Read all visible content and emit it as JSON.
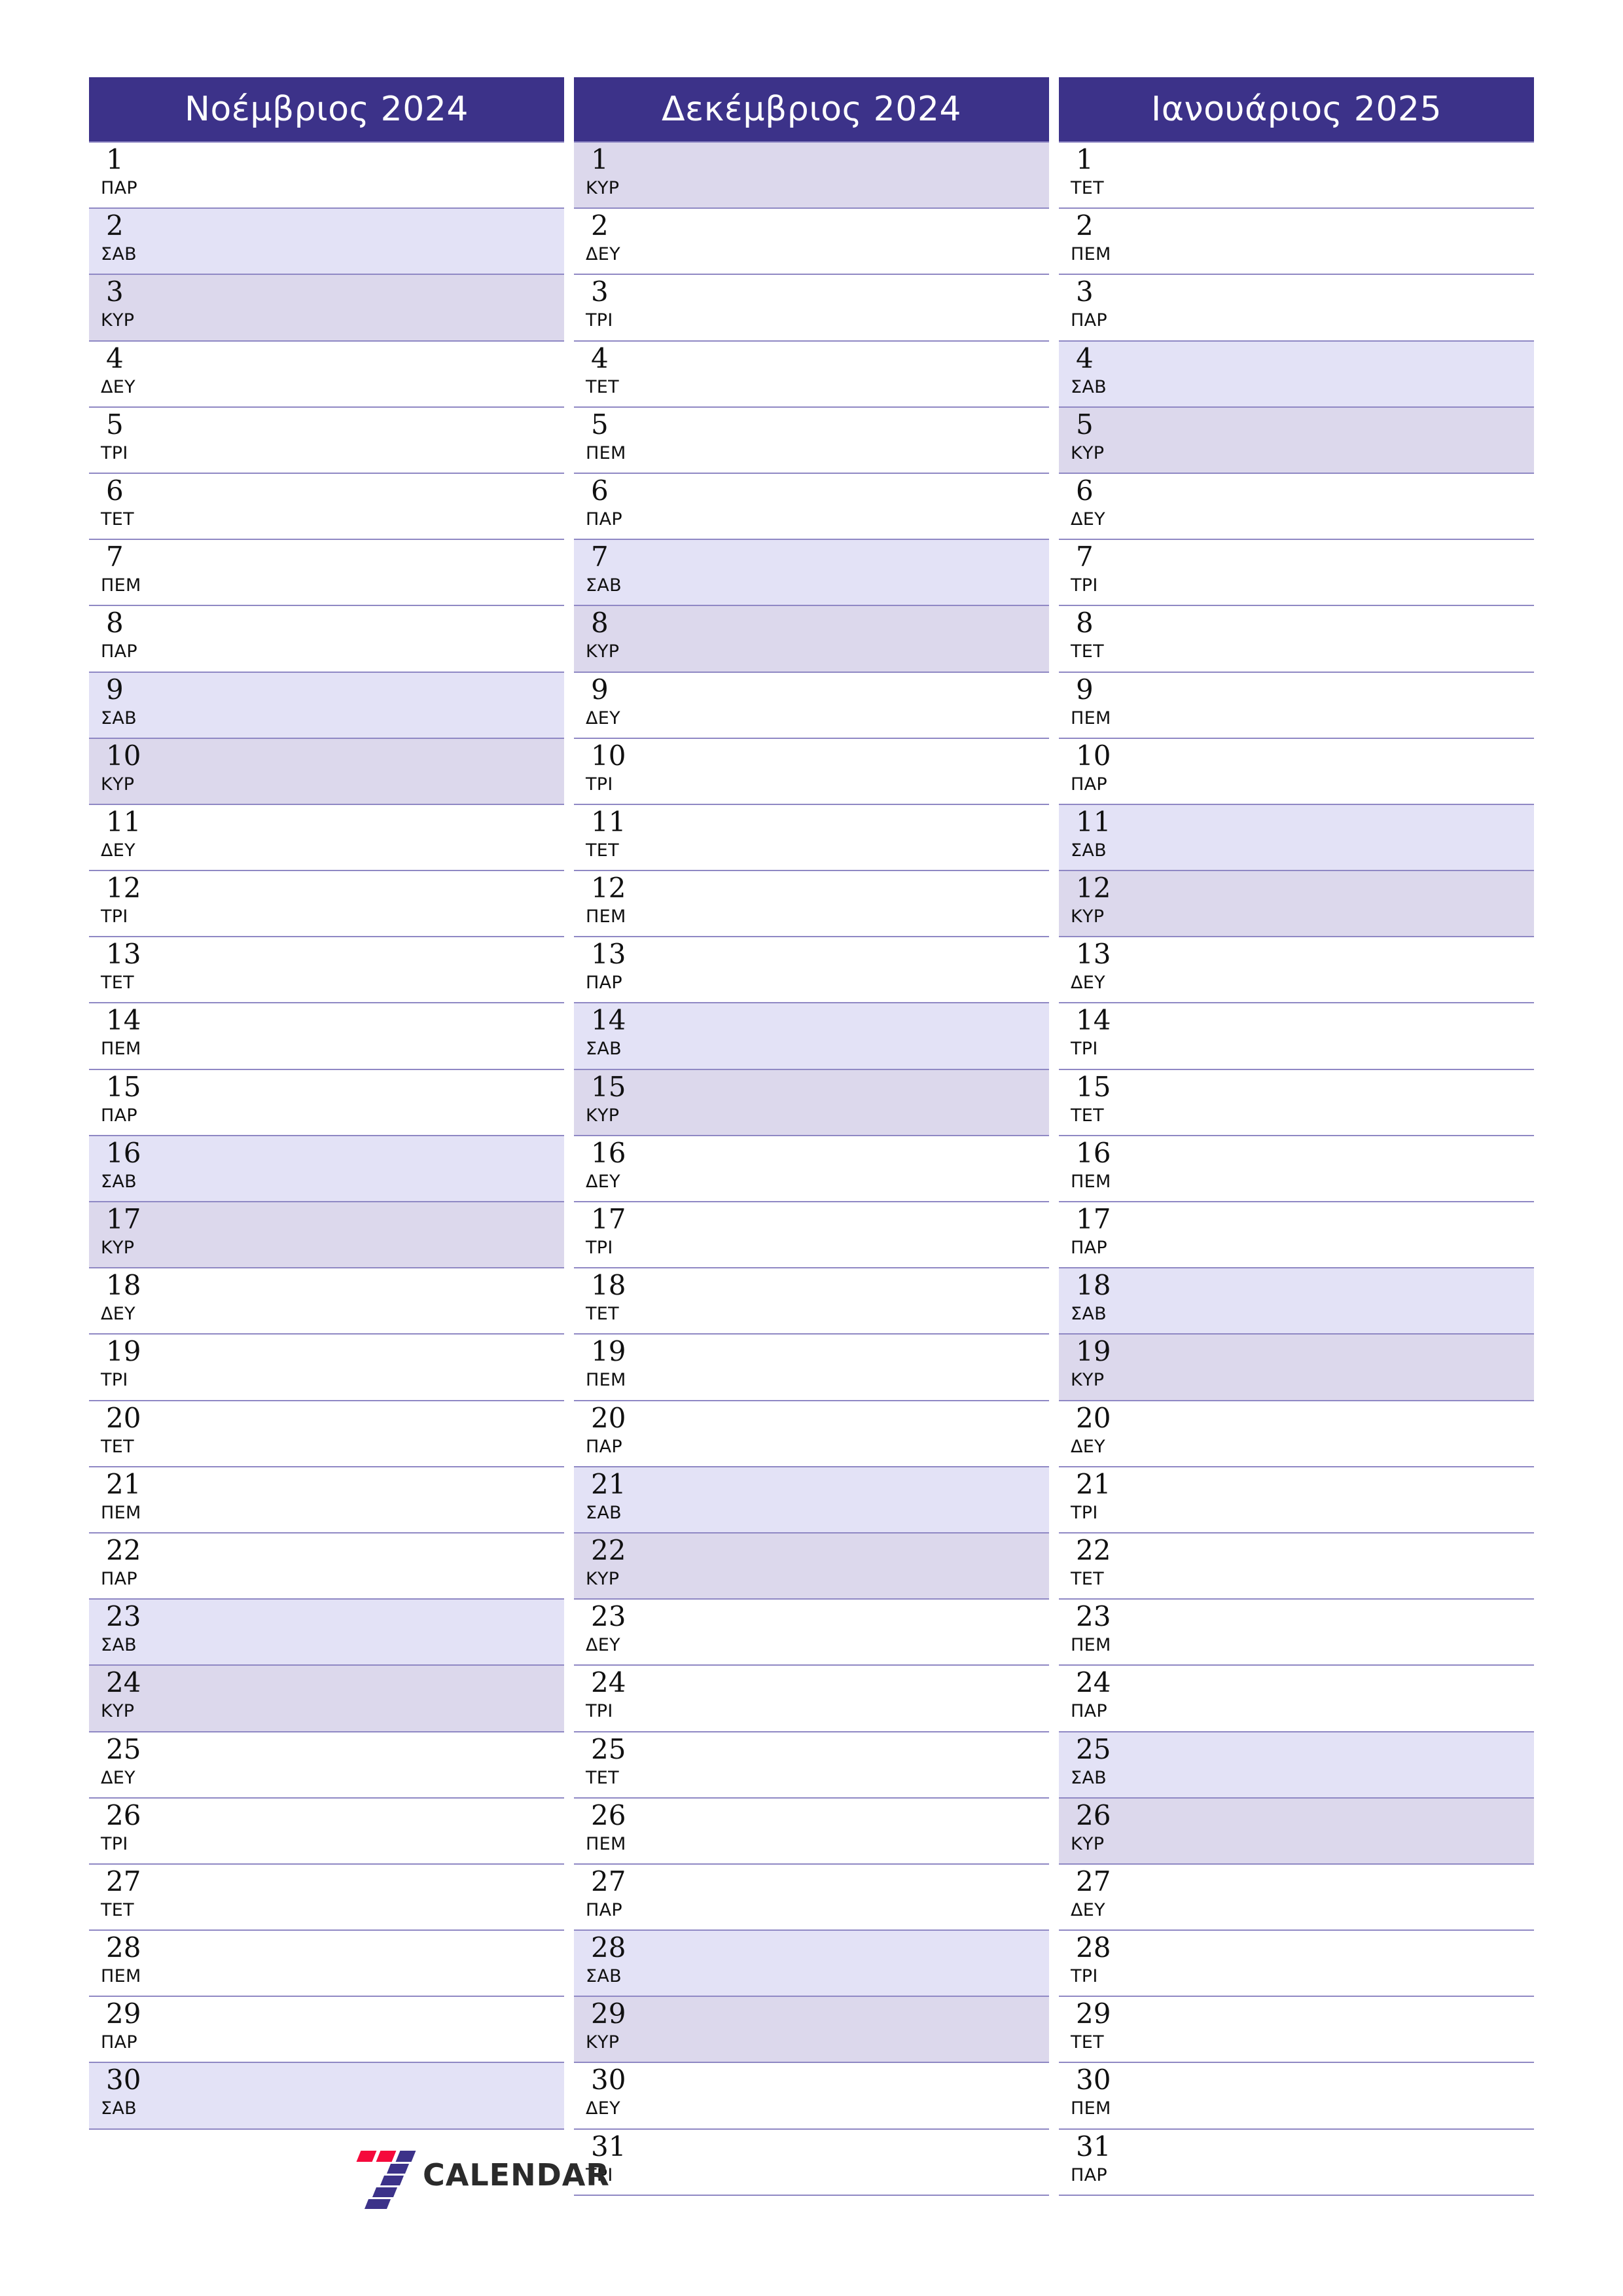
{
  "colors": {
    "header_bg": "#3c3289",
    "header_text": "#ffffff",
    "saturday_bg": "#e3e2f6",
    "sunday_bg": "#dcd8ec",
    "row_border": "#8f88c4",
    "day_text": "#101010",
    "brand_red": "#f50a3c",
    "brand_purple": "#3c3289"
  },
  "brand": {
    "mark": "seven-logo-icon",
    "name": "CALENDAR"
  },
  "months": [
    {
      "title": "Νοέμβριος 2024",
      "days": [
        {
          "num": "1",
          "dow": "ΠΑΡ",
          "type": "weekday"
        },
        {
          "num": "2",
          "dow": "ΣΑΒ",
          "type": "sat"
        },
        {
          "num": "3",
          "dow": "ΚΥΡ",
          "type": "sun"
        },
        {
          "num": "4",
          "dow": "ΔΕΥ",
          "type": "weekday"
        },
        {
          "num": "5",
          "dow": "ΤΡΙ",
          "type": "weekday"
        },
        {
          "num": "6",
          "dow": "ΤΕΤ",
          "type": "weekday"
        },
        {
          "num": "7",
          "dow": "ΠΕΜ",
          "type": "weekday"
        },
        {
          "num": "8",
          "dow": "ΠΑΡ",
          "type": "weekday"
        },
        {
          "num": "9",
          "dow": "ΣΑΒ",
          "type": "sat"
        },
        {
          "num": "10",
          "dow": "ΚΥΡ",
          "type": "sun"
        },
        {
          "num": "11",
          "dow": "ΔΕΥ",
          "type": "weekday"
        },
        {
          "num": "12",
          "dow": "ΤΡΙ",
          "type": "weekday"
        },
        {
          "num": "13",
          "dow": "ΤΕΤ",
          "type": "weekday"
        },
        {
          "num": "14",
          "dow": "ΠΕΜ",
          "type": "weekday"
        },
        {
          "num": "15",
          "dow": "ΠΑΡ",
          "type": "weekday"
        },
        {
          "num": "16",
          "dow": "ΣΑΒ",
          "type": "sat"
        },
        {
          "num": "17",
          "dow": "ΚΥΡ",
          "type": "sun"
        },
        {
          "num": "18",
          "dow": "ΔΕΥ",
          "type": "weekday"
        },
        {
          "num": "19",
          "dow": "ΤΡΙ",
          "type": "weekday"
        },
        {
          "num": "20",
          "dow": "ΤΕΤ",
          "type": "weekday"
        },
        {
          "num": "21",
          "dow": "ΠΕΜ",
          "type": "weekday"
        },
        {
          "num": "22",
          "dow": "ΠΑΡ",
          "type": "weekday"
        },
        {
          "num": "23",
          "dow": "ΣΑΒ",
          "type": "sat"
        },
        {
          "num": "24",
          "dow": "ΚΥΡ",
          "type": "sun"
        },
        {
          "num": "25",
          "dow": "ΔΕΥ",
          "type": "weekday"
        },
        {
          "num": "26",
          "dow": "ΤΡΙ",
          "type": "weekday"
        },
        {
          "num": "27",
          "dow": "ΤΕΤ",
          "type": "weekday"
        },
        {
          "num": "28",
          "dow": "ΠΕΜ",
          "type": "weekday"
        },
        {
          "num": "29",
          "dow": "ΠΑΡ",
          "type": "weekday"
        },
        {
          "num": "30",
          "dow": "ΣΑΒ",
          "type": "sat"
        }
      ]
    },
    {
      "title": "Δεκέμβριος 2024",
      "days": [
        {
          "num": "1",
          "dow": "ΚΥΡ",
          "type": "sun"
        },
        {
          "num": "2",
          "dow": "ΔΕΥ",
          "type": "weekday"
        },
        {
          "num": "3",
          "dow": "ΤΡΙ",
          "type": "weekday"
        },
        {
          "num": "4",
          "dow": "ΤΕΤ",
          "type": "weekday"
        },
        {
          "num": "5",
          "dow": "ΠΕΜ",
          "type": "weekday"
        },
        {
          "num": "6",
          "dow": "ΠΑΡ",
          "type": "weekday"
        },
        {
          "num": "7",
          "dow": "ΣΑΒ",
          "type": "sat"
        },
        {
          "num": "8",
          "dow": "ΚΥΡ",
          "type": "sun"
        },
        {
          "num": "9",
          "dow": "ΔΕΥ",
          "type": "weekday"
        },
        {
          "num": "10",
          "dow": "ΤΡΙ",
          "type": "weekday"
        },
        {
          "num": "11",
          "dow": "ΤΕΤ",
          "type": "weekday"
        },
        {
          "num": "12",
          "dow": "ΠΕΜ",
          "type": "weekday"
        },
        {
          "num": "13",
          "dow": "ΠΑΡ",
          "type": "weekday"
        },
        {
          "num": "14",
          "dow": "ΣΑΒ",
          "type": "sat"
        },
        {
          "num": "15",
          "dow": "ΚΥΡ",
          "type": "sun"
        },
        {
          "num": "16",
          "dow": "ΔΕΥ",
          "type": "weekday"
        },
        {
          "num": "17",
          "dow": "ΤΡΙ",
          "type": "weekday"
        },
        {
          "num": "18",
          "dow": "ΤΕΤ",
          "type": "weekday"
        },
        {
          "num": "19",
          "dow": "ΠΕΜ",
          "type": "weekday"
        },
        {
          "num": "20",
          "dow": "ΠΑΡ",
          "type": "weekday"
        },
        {
          "num": "21",
          "dow": "ΣΑΒ",
          "type": "sat"
        },
        {
          "num": "22",
          "dow": "ΚΥΡ",
          "type": "sun"
        },
        {
          "num": "23",
          "dow": "ΔΕΥ",
          "type": "weekday"
        },
        {
          "num": "24",
          "dow": "ΤΡΙ",
          "type": "weekday"
        },
        {
          "num": "25",
          "dow": "ΤΕΤ",
          "type": "weekday"
        },
        {
          "num": "26",
          "dow": "ΠΕΜ",
          "type": "weekday"
        },
        {
          "num": "27",
          "dow": "ΠΑΡ",
          "type": "weekday"
        },
        {
          "num": "28",
          "dow": "ΣΑΒ",
          "type": "sat"
        },
        {
          "num": "29",
          "dow": "ΚΥΡ",
          "type": "sun"
        },
        {
          "num": "30",
          "dow": "ΔΕΥ",
          "type": "weekday"
        },
        {
          "num": "31",
          "dow": "ΤΡΙ",
          "type": "weekday"
        }
      ]
    },
    {
      "title": "Ιανουάριος 2025",
      "days": [
        {
          "num": "1",
          "dow": "ΤΕΤ",
          "type": "weekday"
        },
        {
          "num": "2",
          "dow": "ΠΕΜ",
          "type": "weekday"
        },
        {
          "num": "3",
          "dow": "ΠΑΡ",
          "type": "weekday"
        },
        {
          "num": "4",
          "dow": "ΣΑΒ",
          "type": "sat"
        },
        {
          "num": "5",
          "dow": "ΚΥΡ",
          "type": "sun"
        },
        {
          "num": "6",
          "dow": "ΔΕΥ",
          "type": "weekday"
        },
        {
          "num": "7",
          "dow": "ΤΡΙ",
          "type": "weekday"
        },
        {
          "num": "8",
          "dow": "ΤΕΤ",
          "type": "weekday"
        },
        {
          "num": "9",
          "dow": "ΠΕΜ",
          "type": "weekday"
        },
        {
          "num": "10",
          "dow": "ΠΑΡ",
          "type": "weekday"
        },
        {
          "num": "11",
          "dow": "ΣΑΒ",
          "type": "sat"
        },
        {
          "num": "12",
          "dow": "ΚΥΡ",
          "type": "sun"
        },
        {
          "num": "13",
          "dow": "ΔΕΥ",
          "type": "weekday"
        },
        {
          "num": "14",
          "dow": "ΤΡΙ",
          "type": "weekday"
        },
        {
          "num": "15",
          "dow": "ΤΕΤ",
          "type": "weekday"
        },
        {
          "num": "16",
          "dow": "ΠΕΜ",
          "type": "weekday"
        },
        {
          "num": "17",
          "dow": "ΠΑΡ",
          "type": "weekday"
        },
        {
          "num": "18",
          "dow": "ΣΑΒ",
          "type": "sat"
        },
        {
          "num": "19",
          "dow": "ΚΥΡ",
          "type": "sun"
        },
        {
          "num": "20",
          "dow": "ΔΕΥ",
          "type": "weekday"
        },
        {
          "num": "21",
          "dow": "ΤΡΙ",
          "type": "weekday"
        },
        {
          "num": "22",
          "dow": "ΤΕΤ",
          "type": "weekday"
        },
        {
          "num": "23",
          "dow": "ΠΕΜ",
          "type": "weekday"
        },
        {
          "num": "24",
          "dow": "ΠΑΡ",
          "type": "weekday"
        },
        {
          "num": "25",
          "dow": "ΣΑΒ",
          "type": "sat"
        },
        {
          "num": "26",
          "dow": "ΚΥΡ",
          "type": "sun"
        },
        {
          "num": "27",
          "dow": "ΔΕΥ",
          "type": "weekday"
        },
        {
          "num": "28",
          "dow": "ΤΡΙ",
          "type": "weekday"
        },
        {
          "num": "29",
          "dow": "ΤΕΤ",
          "type": "weekday"
        },
        {
          "num": "30",
          "dow": "ΠΕΜ",
          "type": "weekday"
        },
        {
          "num": "31",
          "dow": "ΠΑΡ",
          "type": "weekday"
        }
      ]
    }
  ]
}
